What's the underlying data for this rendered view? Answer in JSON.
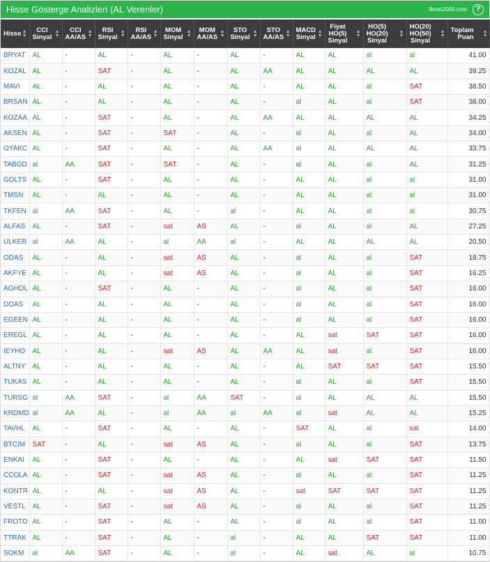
{
  "header": {
    "title": "Hisse Gösterge Analizleri (AL Verenler)",
    "site": "finnet2000.com",
    "help_glyph": "?"
  },
  "colors": {
    "header_bg": "#28b54a",
    "table_head_bg": "#3c3c3c",
    "al": "#2e9e2e",
    "sat": "#d42424",
    "symbol": "#2e6bb8"
  },
  "columns": [
    {
      "key": "hisse",
      "l1": "Hisse",
      "l2": "",
      "l3": ""
    },
    {
      "key": "cci_sinyal",
      "l1": "CCI",
      "l2": "Sinyal",
      "l3": ""
    },
    {
      "key": "cci_aaas",
      "l1": "CCI",
      "l2": "AA/AS",
      "l3": ""
    },
    {
      "key": "rsi_sinyal",
      "l1": "RSI",
      "l2": "Sinyal",
      "l3": ""
    },
    {
      "key": "rsi_aaas",
      "l1": "RSI",
      "l2": "AA/AS",
      "l3": ""
    },
    {
      "key": "mom_sinyal",
      "l1": "MOM",
      "l2": "Sinyal",
      "l3": ""
    },
    {
      "key": "mom_aaas",
      "l1": "MOM",
      "l2": "AA/AS",
      "l3": ""
    },
    {
      "key": "sto_sinyal",
      "l1": "STO",
      "l2": "Sinyal",
      "l3": ""
    },
    {
      "key": "sto_aaas",
      "l1": "STO",
      "l2": "AA/AS",
      "l3": ""
    },
    {
      "key": "macd_sinyal",
      "l1": "MACD",
      "l2": "Sinyal",
      "l3": ""
    },
    {
      "key": "fiyat_ho5",
      "l1": "Fiyat",
      "l2": "HO(5)",
      "l3": "Sinyal"
    },
    {
      "key": "ho5_ho20",
      "l1": "HO(5)",
      "l2": "HO(20)",
      "l3": "Sinyal"
    },
    {
      "key": "ho20_ho50",
      "l1": "HO(20)",
      "l2": "HO(50)",
      "l3": "Sinyal"
    },
    {
      "key": "toplam",
      "l1": "Toplam",
      "l2": "Puan",
      "l3": ""
    }
  ],
  "rows": [
    [
      "BRYAT",
      "AL",
      "-",
      "AL",
      "-",
      "AL",
      "-",
      "AL",
      "-",
      "AL",
      "AL",
      "al",
      "al",
      "41.00"
    ],
    [
      "KOZAL",
      "AL",
      "-",
      "SAT",
      "-",
      "AL",
      "-",
      "AL",
      "AA",
      "AL",
      "AL",
      "AL",
      "AL",
      "39.25"
    ],
    [
      "MAVI",
      "AL",
      "-",
      "AL",
      "-",
      "AL",
      "-",
      "AL",
      "-",
      "AL",
      "AL",
      "al",
      "SAT",
      "38.50"
    ],
    [
      "BRSAN",
      "AL",
      "-",
      "AL",
      "-",
      "AL",
      "-",
      "AL",
      "-",
      "al",
      "AL",
      "al",
      "SAT",
      "38.00"
    ],
    [
      "KOZAA",
      "AL",
      "-",
      "SAT",
      "-",
      "AL",
      "-",
      "AL",
      "AA",
      "AL",
      "AL",
      "AL",
      "AL",
      "34.25"
    ],
    [
      "AKSEN",
      "AL",
      "-",
      "SAT",
      "-",
      "SAT",
      "-",
      "AL",
      "-",
      "al",
      "AL",
      "al",
      "AL",
      "34.00"
    ],
    [
      "OYAKC",
      "AL",
      "-",
      "SAT",
      "-",
      "AL",
      "-",
      "AL",
      "AA",
      "al",
      "AL",
      "AL",
      "AL",
      "33.75"
    ],
    [
      "TABGD",
      "al",
      "AA",
      "SAT",
      "-",
      "SAT",
      "-",
      "AL",
      "-",
      "al",
      "AL",
      "al",
      "AL",
      "31.25"
    ],
    [
      "GOLTS",
      "AL",
      "-",
      "SAT",
      "-",
      "AL",
      "-",
      "AL",
      "-",
      "AL",
      "AL",
      "al",
      "al",
      "31.00"
    ],
    [
      "TMSN",
      "AL",
      "-",
      "AL",
      "-",
      "AL",
      "-",
      "AL",
      "-",
      "AL",
      "AL",
      "al",
      "al",
      "31.00"
    ],
    [
      "TKFEN",
      "al",
      "AA",
      "SAT",
      "-",
      "AL",
      "-",
      "al",
      "-",
      "AL",
      "AL",
      "al",
      "al",
      "30.75"
    ],
    [
      "ALFAS",
      "AL",
      "-",
      "SAT",
      "-",
      "sat",
      "AS",
      "AL",
      "-",
      "al",
      "AL",
      "al",
      "AL",
      "27.25"
    ],
    [
      "ULKER",
      "al",
      "AA",
      "AL",
      "-",
      "al",
      "AA",
      "al",
      "-",
      "AL",
      "AL",
      "AL",
      "AL",
      "20.50"
    ],
    [
      "ODAS",
      "AL",
      "-",
      "AL",
      "-",
      "sat",
      "AS",
      "AL",
      "-",
      "al",
      "AL",
      "al",
      "SAT",
      "18.75"
    ],
    [
      "AKFYE",
      "AL",
      "-",
      "AL",
      "-",
      "sat",
      "AS",
      "AL",
      "-",
      "al",
      "AL",
      "al",
      "SAT",
      "16.25"
    ],
    [
      "AGHOL",
      "AL",
      "-",
      "SAT",
      "-",
      "AL",
      "-",
      "AL",
      "-",
      "al",
      "AL",
      "al",
      "SAT",
      "16.00"
    ],
    [
      "DOAS",
      "AL",
      "-",
      "AL",
      "-",
      "AL",
      "-",
      "AL",
      "-",
      "al",
      "AL",
      "al",
      "SAT",
      "16.00"
    ],
    [
      "EGEEN",
      "AL",
      "-",
      "AL",
      "-",
      "AL",
      "-",
      "AL",
      "-",
      "al",
      "AL",
      "al",
      "SAT",
      "16.00"
    ],
    [
      "EREGL",
      "AL",
      "-",
      "AL",
      "-",
      "AL",
      "-",
      "AL",
      "-",
      "AL",
      "sat",
      "SAT",
      "SAT",
      "16.00"
    ],
    [
      "IEYHO",
      "AL",
      "-",
      "AL",
      "-",
      "sat",
      "AS",
      "AL",
      "AA",
      "AL",
      "sat",
      "al",
      "SAT",
      "16.00"
    ],
    [
      "ALTNY",
      "AL",
      "-",
      "AL",
      "-",
      "AL",
      "-",
      "AL",
      "-",
      "AL",
      "SAT",
      "SAT",
      "SAT",
      "15.50"
    ],
    [
      "TUKAS",
      "AL",
      "-",
      "AL",
      "-",
      "AL",
      "-",
      "AL",
      "-",
      "al",
      "AL",
      "al",
      "SAT",
      "15.50"
    ],
    [
      "TURSG",
      "al",
      "AA",
      "SAT",
      "-",
      "al",
      "AA",
      "SAT",
      "-",
      "al",
      "AL",
      "AL",
      "AL",
      "15.50"
    ],
    [
      "KRDMD",
      "al",
      "AA",
      "AL",
      "-",
      "al",
      "AA",
      "al",
      "AA",
      "al",
      "sat",
      "AL",
      "AL",
      "15.25"
    ],
    [
      "TAVHL",
      "AL",
      "-",
      "SAT",
      "-",
      "AL",
      "-",
      "AL",
      "-",
      "SAT",
      "AL",
      "al",
      "sat",
      "14.00"
    ],
    [
      "BTCIM",
      "SAT",
      "-",
      "AL",
      "-",
      "sat",
      "AS",
      "AL",
      "-",
      "al",
      "AL",
      "al",
      "SAT",
      "13.75"
    ],
    [
      "ENKAI",
      "AL",
      "-",
      "SAT",
      "-",
      "AL",
      "-",
      "AL",
      "-",
      "AL",
      "sat",
      "SAT",
      "SAT",
      "11.50"
    ],
    [
      "CCOLA",
      "AL",
      "-",
      "SAT",
      "-",
      "sat",
      "AS",
      "AL",
      "-",
      "al",
      "AL",
      "al",
      "SAT",
      "11.25"
    ],
    [
      "KONTR",
      "AL",
      "-",
      "AL",
      "-",
      "sat",
      "AS",
      "AL",
      "-",
      "sat",
      "SAT",
      "SAT",
      "SAT",
      "11.25"
    ],
    [
      "VESTL",
      "AL",
      "-",
      "SAT",
      "-",
      "sat",
      "AS",
      "AL",
      "-",
      "al",
      "AL",
      "al",
      "SAT",
      "11.25"
    ],
    [
      "FROTO",
      "AL",
      "-",
      "SAT",
      "-",
      "AL",
      "-",
      "AL",
      "-",
      "al",
      "AL",
      "al",
      "SAT",
      "11.00"
    ],
    [
      "TTRAK",
      "AL",
      "-",
      "SAT",
      "-",
      "AL",
      "-",
      "al",
      "-",
      "AL",
      "AL",
      "SAT",
      "SAT",
      "11.00"
    ],
    [
      "SOKM",
      "al",
      "AA",
      "SAT",
      "-",
      "AL",
      "-",
      "al",
      "-",
      "AL",
      "sat",
      "AL",
      "al",
      "10.75"
    ]
  ]
}
